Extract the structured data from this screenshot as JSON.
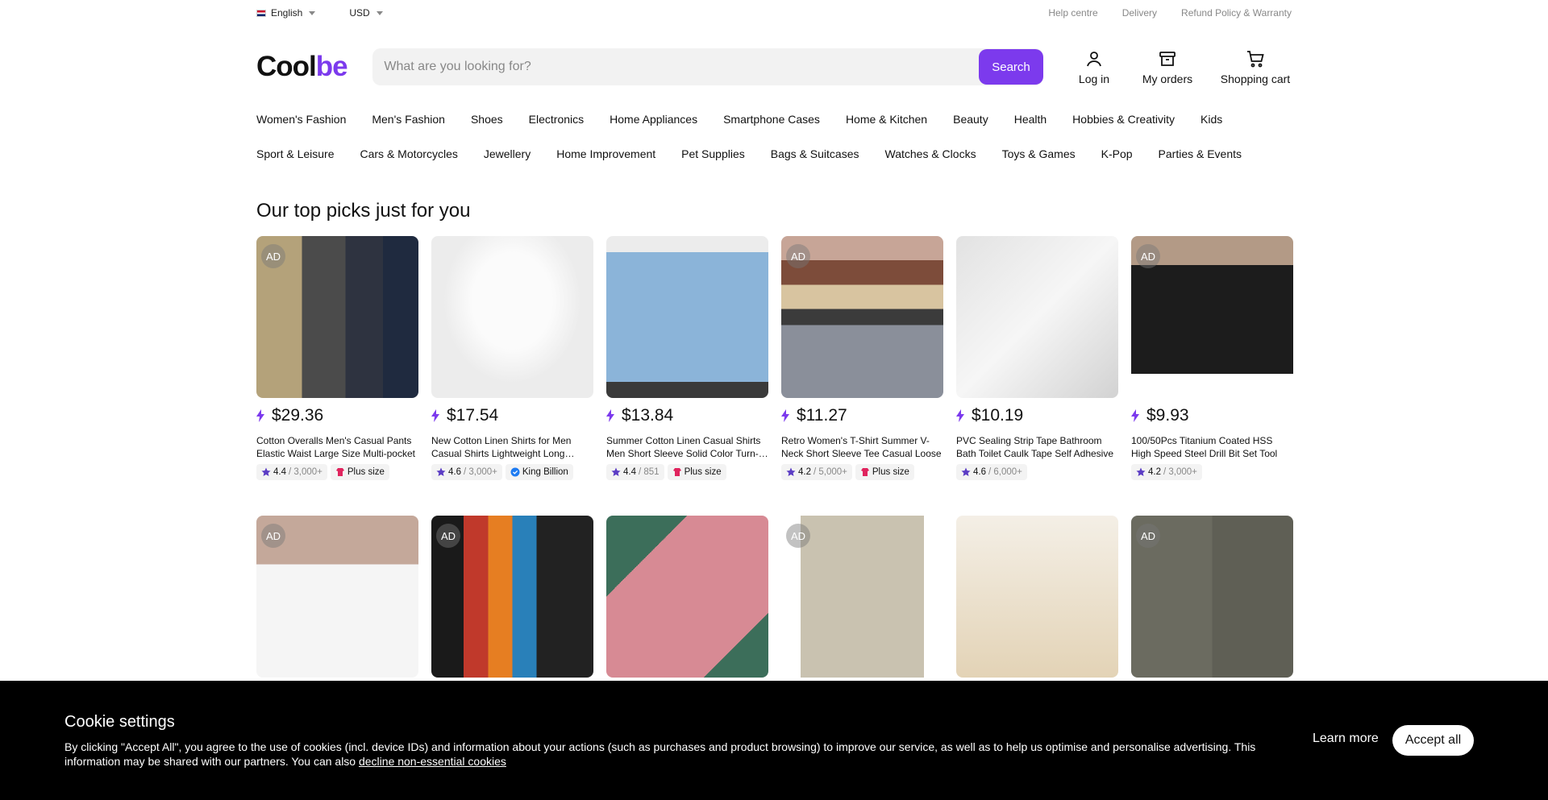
{
  "topbar": {
    "language": "English",
    "currency": "USD",
    "links": [
      "Help centre",
      "Delivery",
      "Refund Policy & Warranty"
    ]
  },
  "header": {
    "logo_main": "Cool",
    "logo_accent": "be",
    "search_placeholder": "What are you looking for?",
    "search_button": "Search",
    "login": "Log in",
    "orders": "My orders",
    "cart": "Shopping cart"
  },
  "categories": {
    "row1": [
      "Women's Fashion",
      "Men's Fashion",
      "Shoes",
      "Electronics",
      "Home Appliances",
      "Smartphone Cases",
      "Home & Kitchen",
      "Beauty",
      "Health",
      "Hobbies & Creativity",
      "Kids"
    ],
    "row2": [
      "Sport & Leisure",
      "Cars & Motorcycles",
      "Jewellery",
      "Home Improvement",
      "Pet Supplies",
      "Bags & Suitcases",
      "Watches & Clocks",
      "Toys & Games",
      "K-Pop",
      "Parties & Events"
    ]
  },
  "section_title": "Our top picks just for you",
  "products": [
    {
      "ad": "AD",
      "price": "$29.36",
      "name": "Cotton Overalls Men's Casual Pants Elastic Waist Large Size Multi-pocket",
      "rating": "4.4",
      "reviews": "/ 3,000+",
      "badge": "Plus size",
      "badge_type": "plus"
    },
    {
      "ad": "",
      "price": "$17.54",
      "name": "New Cotton Linen Shirts for Men Casual Shirts Lightweight Long Sleeve",
      "rating": "4.6",
      "reviews": "/ 3,000+",
      "badge": "King Billion",
      "badge_type": "verified"
    },
    {
      "ad": "",
      "price": "$13.84",
      "name": "Summer Cotton Linen Casual Shirts Men Short Sleeve Solid Color Turn-down",
      "rating": "4.4",
      "reviews": "/ 851",
      "badge": "Plus size",
      "badge_type": "plus"
    },
    {
      "ad": "AD",
      "price": "$11.27",
      "name": "Retro Women's T-Shirt Summer V-Neck Short Sleeve Tee Casual Loose",
      "rating": "4.2",
      "reviews": "/ 5,000+",
      "badge": "Plus size",
      "badge_type": "plus"
    },
    {
      "ad": "",
      "price": "$10.19",
      "name": "PVC Sealing Strip Tape Bathroom Bath Toilet Caulk Tape Self Adhesive",
      "rating": "4.6",
      "reviews": "/ 6,000+",
      "badge": "",
      "badge_type": ""
    },
    {
      "ad": "AD",
      "price": "$9.93",
      "name": "100/50Pcs Titanium Coated HSS High Speed Steel Drill Bit Set Tool",
      "rating": "4.2",
      "reviews": "/ 3,000+",
      "badge": "",
      "badge_type": ""
    }
  ],
  "products_row2": [
    {
      "ad": "AD"
    },
    {
      "ad": "AD"
    },
    {
      "ad": ""
    },
    {
      "ad": "AD"
    },
    {
      "ad": ""
    },
    {
      "ad": "AD"
    }
  ],
  "cookie": {
    "title": "Cookie settings",
    "text": "By clicking \"Accept All\", you agree to the use of cookies (incl. device IDs) and information about your actions (such as purchases and product browsing) to improve our service, as well as to help us optimise and personalise advertising. This information may be shared with our partners. You can also ",
    "decline_link": "decline non-essential cookies",
    "learn_more": "Learn more",
    "accept_all": "Accept all"
  },
  "colors": {
    "accent": "#7c3aed",
    "banner": "#000000"
  }
}
